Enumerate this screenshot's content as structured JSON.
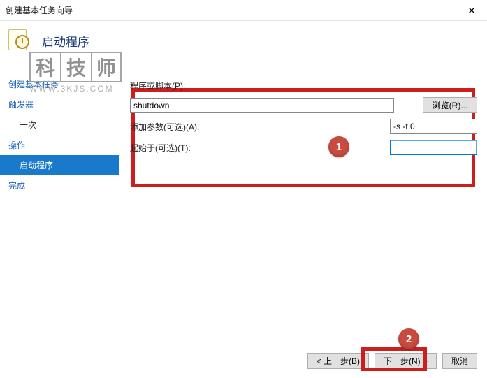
{
  "window": {
    "title": "创建基本任务向导"
  },
  "heading": "启动程序",
  "watermark": {
    "chars": [
      "科",
      "技",
      "师"
    ],
    "url": "WWW.3KJS.COM"
  },
  "sidebar": {
    "items": [
      {
        "label": "创建基本任务"
      },
      {
        "label": "触发器"
      },
      {
        "label": "一次"
      },
      {
        "label": "操作"
      },
      {
        "label": "启动程序"
      },
      {
        "label": "完成"
      }
    ]
  },
  "form": {
    "script_label": "程序或脚本(P):",
    "script_value": "shutdown",
    "browse_label": "浏览(R)...",
    "args_label": "添加参数(可选)(A):",
    "args_value": "-s -t 0",
    "startin_label": "起始于(可选)(T):",
    "startin_value": ""
  },
  "badges": {
    "one": "1",
    "two": "2"
  },
  "footer": {
    "back": "< 上一步(B)",
    "next": "下一步(N) >",
    "cancel": "取消"
  }
}
